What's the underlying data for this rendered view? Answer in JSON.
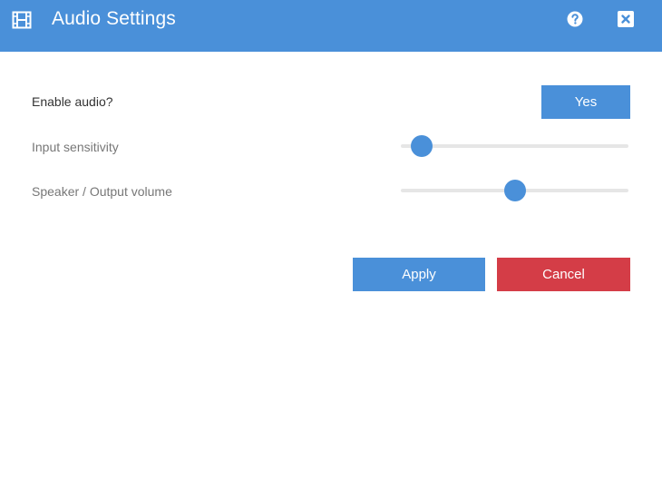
{
  "window": {
    "title": "Audio Settings",
    "title_icon": "film-icon",
    "help_icon": "question-circle-icon",
    "close_icon": "close-icon"
  },
  "settings": {
    "enable_audio": {
      "label": "Enable audio?",
      "button_label": "Yes"
    },
    "input_sensitivity": {
      "label": "Input sensitivity",
      "value": 0.05
    },
    "speaker_volume": {
      "label": "Speaker / Output volume",
      "value": 0.5
    }
  },
  "actions": {
    "apply_label": "Apply",
    "cancel_label": "Cancel"
  },
  "colors": {
    "accent": "#4a90d9",
    "danger": "#d43d47",
    "track": "#e6e6e6"
  }
}
